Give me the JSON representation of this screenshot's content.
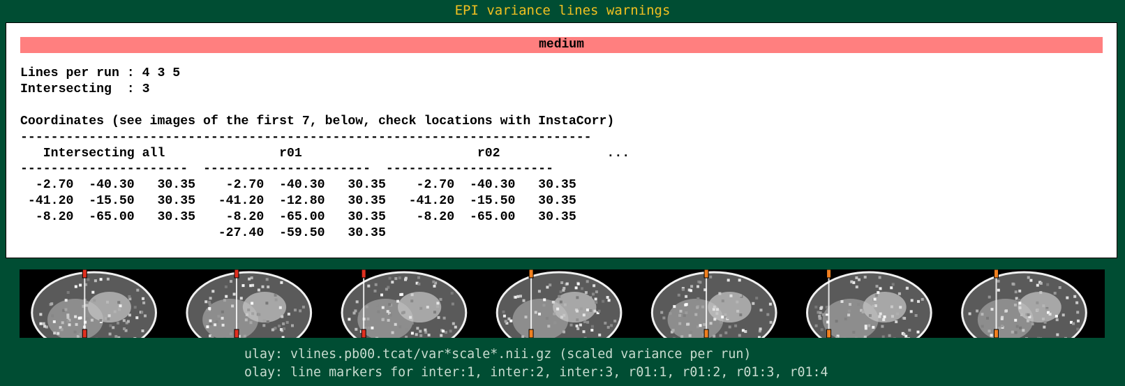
{
  "header": {
    "title": "EPI variance lines warnings"
  },
  "report": {
    "severity": "medium",
    "lines_per_run": "Lines per run : 4 3 5",
    "intersecting": "Intersecting  : 3",
    "coordinates_heading": "Coordinates (see images of the first 7, below, check locations with InstaCorr)",
    "rule_long": "---------------------------------------------------------------------------",
    "column_headers": "   Intersecting all               r01                       r02              ...",
    "rule_columns": "----------------------  ----------------------  ----------------------",
    "rows": [
      "  -2.70  -40.30   30.35    -2.70  -40.30   30.35    -2.70  -40.30   30.35",
      " -41.20  -15.50   30.35   -41.20  -12.80   30.35   -41.20  -15.50   30.35",
      "  -8.20  -65.00   30.35    -8.20  -65.00   30.35    -8.20  -65.00   30.35",
      "                          -27.40  -59.50   30.35"
    ]
  },
  "image_strip": {
    "panel_count": 7,
    "marker_colors": [
      "#e03020",
      "#e03020",
      "#e03020",
      "#f08020",
      "#f08020",
      "#f08020",
      "#f08020"
    ],
    "marker_positions": [
      0.42,
      0.4,
      0.22,
      0.3,
      0.43,
      0.22,
      0.3
    ]
  },
  "captions": {
    "ulay": "ulay: vlines.pb00.tcat/var*scale*.nii.gz (scaled variance per run)",
    "olay": "olay: line markers for inter:1, inter:2, inter:3, r01:1, r01:2, r01:3, r01:4"
  }
}
